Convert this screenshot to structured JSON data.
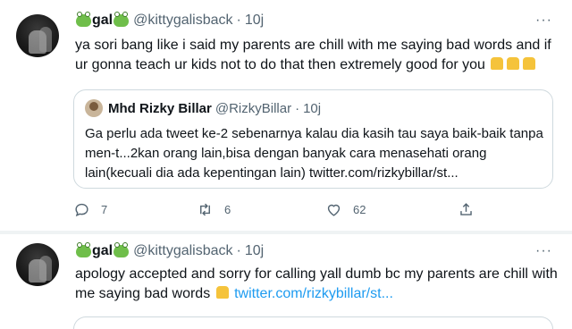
{
  "tweets": [
    {
      "name": "gal",
      "handle": "@kittygalisback",
      "separator": "·",
      "time": "10j",
      "more": "···",
      "text": "ya sori bang like i said my parents are chill with me saying bad words and if ur gonna teach ur kids not to do that then extremely good for you",
      "quote": {
        "name": "Mhd Rizky Billar",
        "handle": "@RizkyBillar",
        "separator": "·",
        "time": "10j",
        "text": "Ga perlu ada tweet ke-2 sebenarnya kalau dia kasih tau saya baik-baik tanpa men-t...2kan orang lain,bisa dengan banyak cara menasehati orang lain(kecuali dia ada kepentingan lain) twitter.com/rizkybillar/st..."
      },
      "actions": {
        "replies": "7",
        "retweets": "6",
        "likes": "62"
      }
    },
    {
      "name": "gal",
      "handle": "@kittygalisback",
      "separator": "·",
      "time": "10j",
      "more": "···",
      "text": "apology accepted and sorry for calling yall dumb bc my parents are chill with me saying bad words",
      "link": "twitter.com/rizkybillar/st..."
    }
  ],
  "colors": {
    "accent": "#1d9bf0",
    "secondary_text": "#536471",
    "border": "#cfd9de"
  },
  "icons": [
    "frog-emoji-icon",
    "folded-hands-emoji-icon",
    "reply-icon",
    "retweet-icon",
    "like-icon",
    "share-icon",
    "more-icon"
  ]
}
